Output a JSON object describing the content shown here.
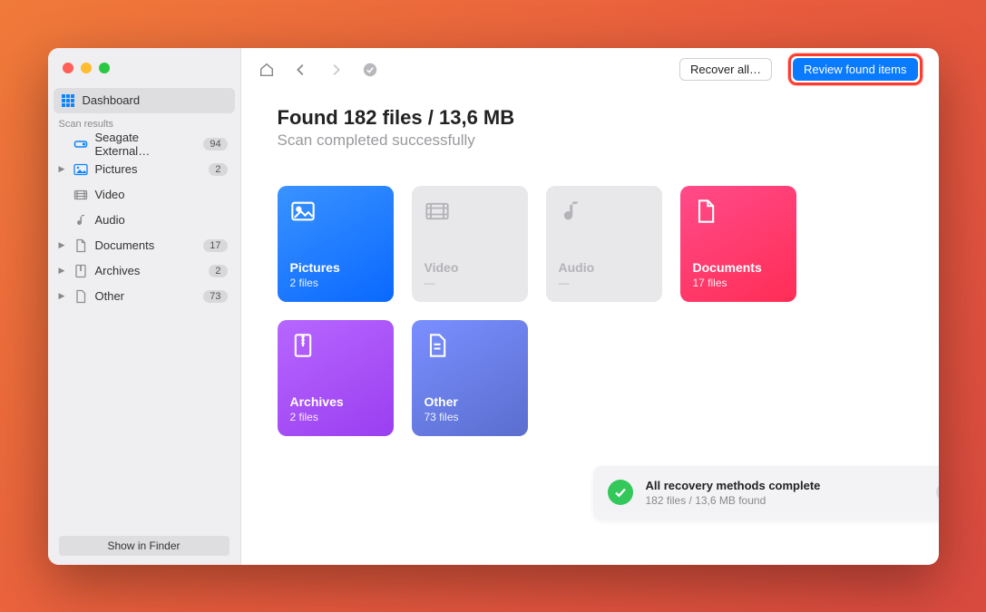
{
  "sidebar": {
    "dashboard_label": "Dashboard",
    "section_label": "Scan results",
    "items": [
      {
        "label": "Seagate External…",
        "badge": "94",
        "icon": "drive"
      },
      {
        "label": "Pictures",
        "badge": "2",
        "icon": "image",
        "expandable": true
      },
      {
        "label": "Video",
        "badge": "",
        "icon": "video"
      },
      {
        "label": "Audio",
        "badge": "",
        "icon": "audio"
      },
      {
        "label": "Documents",
        "badge": "17",
        "icon": "doc",
        "expandable": true
      },
      {
        "label": "Archives",
        "badge": "2",
        "icon": "archive",
        "expandable": true
      },
      {
        "label": "Other",
        "badge": "73",
        "icon": "other",
        "expandable": true
      }
    ],
    "show_in_finder_label": "Show in Finder"
  },
  "toolbar": {
    "recover_all_label": "Recover all…",
    "review_label": "Review found items"
  },
  "main": {
    "title": "Found 182 files / 13,6 MB",
    "subtitle": "Scan completed successfully",
    "cards": {
      "pictures": {
        "title": "Pictures",
        "sub": "2 files"
      },
      "video": {
        "title": "Video",
        "sub": "—"
      },
      "audio": {
        "title": "Audio",
        "sub": "—"
      },
      "documents": {
        "title": "Documents",
        "sub": "17 files"
      },
      "archives": {
        "title": "Archives",
        "sub": "2 files"
      },
      "other": {
        "title": "Other",
        "sub": "73 files"
      }
    }
  },
  "notification": {
    "title": "All recovery methods complete",
    "subtitle": "182 files / 13,6 MB found"
  }
}
